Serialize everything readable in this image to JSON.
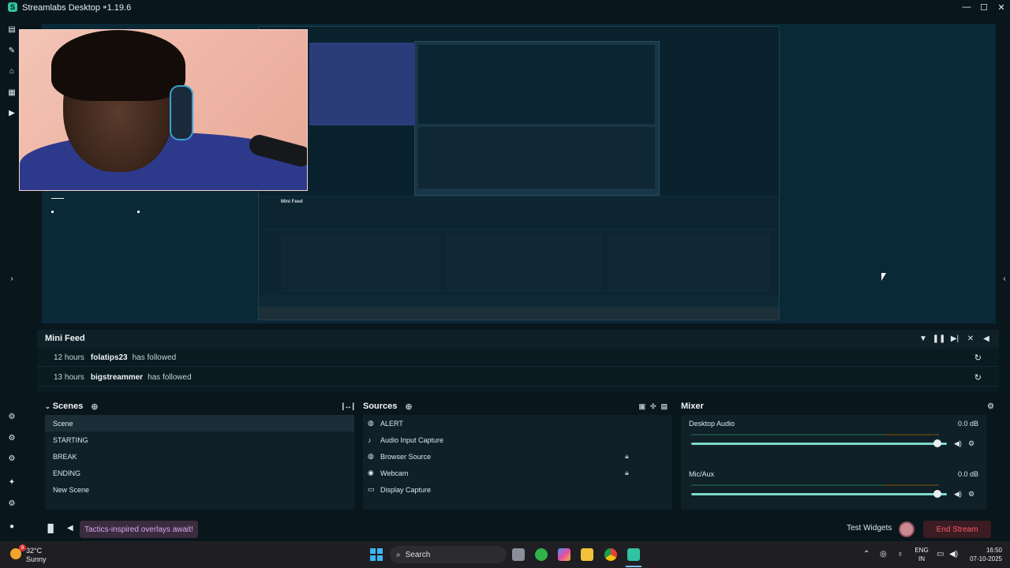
{
  "window": {
    "title": "Streamlabs Desktop ⁍1.19.6",
    "minimize": "—",
    "maximize": "☐",
    "close": "✕"
  },
  "nav": {
    "icons": [
      "editor-icon",
      "themes-icon",
      "store-icon",
      "layout-icon",
      "play-icon",
      "widget-icon-1",
      "widget-icon-2",
      "widget-icon-3",
      "highlighter-icon",
      "settings-icon",
      "profile-icon"
    ]
  },
  "minifeed": {
    "title": "Mini Feed",
    "events": [
      {
        "time": "12 hours",
        "name": "folatips23",
        "action": "has followed"
      },
      {
        "time": "13 hours",
        "name": "bigstreammer",
        "action": "has followed"
      }
    ]
  },
  "scenes": {
    "title": "Scenes",
    "items": [
      "Scene",
      "STARTING",
      "BREAK",
      "ENDING",
      "New Scene"
    ],
    "active_index": 0
  },
  "sources": {
    "title": "Sources",
    "items": [
      {
        "label": "ALERT",
        "icon": "globe-icon",
        "locked": false
      },
      {
        "label": "Audio Input Capture",
        "icon": "mic-icon",
        "locked": false
      },
      {
        "label": "Browser Source",
        "icon": "globe-icon",
        "locked": true
      },
      {
        "label": "Webcam",
        "icon": "webcam-icon",
        "locked": true
      },
      {
        "label": "Display Capture",
        "icon": "monitor-icon",
        "locked": false
      }
    ]
  },
  "mixer": {
    "title": "Mixer",
    "items": [
      {
        "label": "Desktop Audio",
        "db": "0.0 dB",
        "volume": 1.0
      },
      {
        "label": "Mic/Aux",
        "db": "0.0 dB",
        "volume": 1.0
      }
    ]
  },
  "footer": {
    "banner": "Tactics-inspired overlays await!",
    "test_widgets": "Test Widgets",
    "end_stream": "End Stream"
  },
  "taskbar": {
    "weather_temp": "32°C",
    "weather_desc": "Sunny",
    "weather_badge": "8",
    "search": "Search",
    "lang_top": "ENG",
    "lang_bottom": "IN",
    "time": "16:50",
    "date": "07-10-2025"
  },
  "colors": {
    "accent": "#31c3a2",
    "end_stream": "#ff5b6d",
    "banner_text": "#d9a6f0",
    "slider": "#7fd9cc"
  }
}
